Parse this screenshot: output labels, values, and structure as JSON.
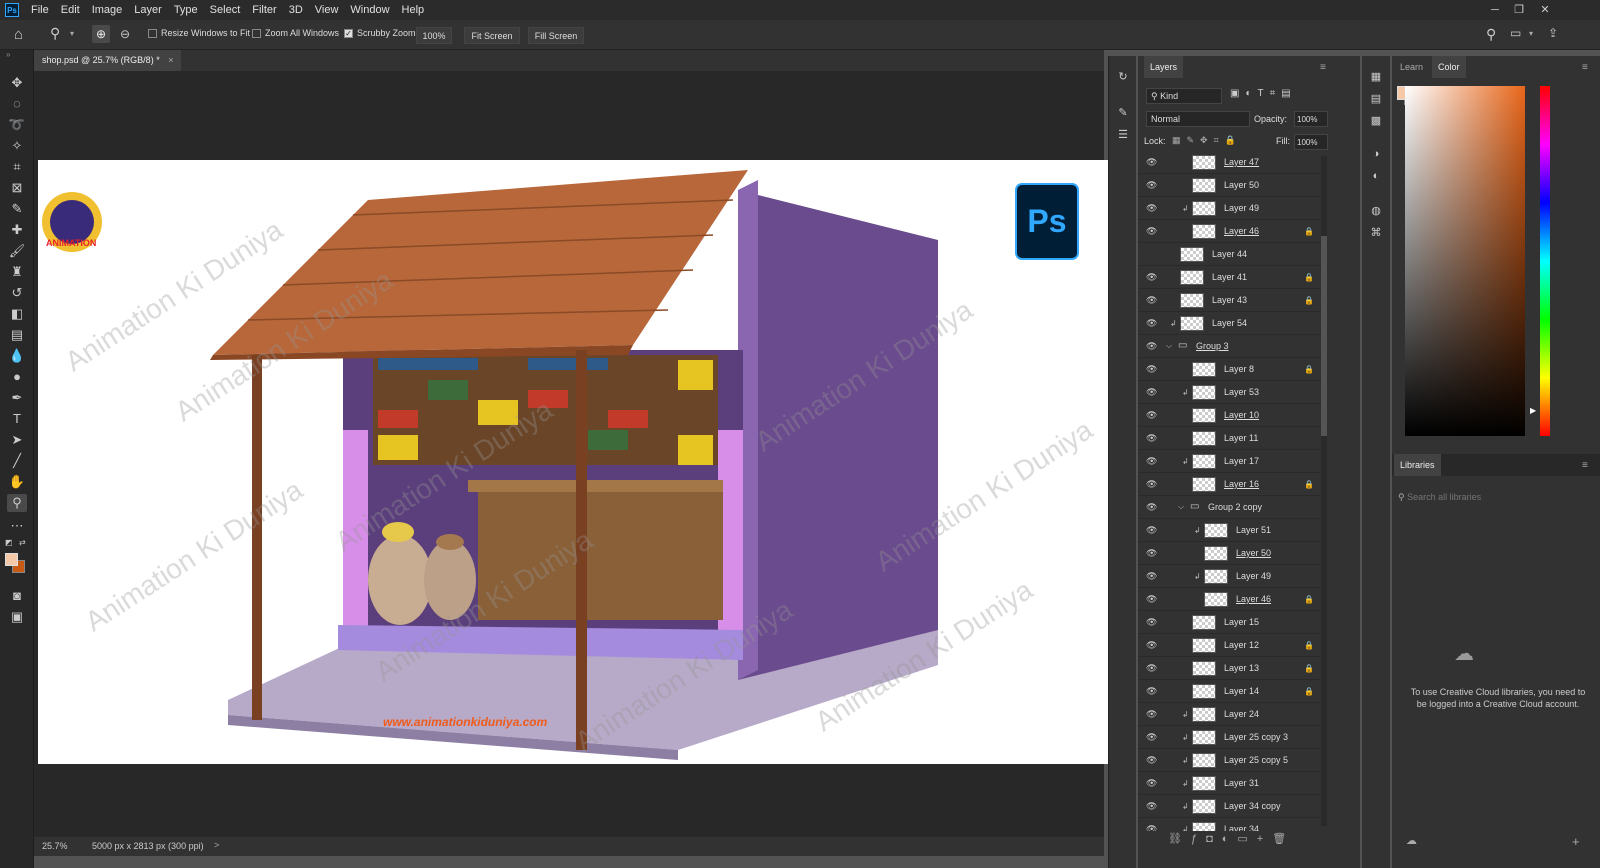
{
  "menubar": {
    "logo": "Ps",
    "items": [
      "File",
      "Edit",
      "Image",
      "Layer",
      "Type",
      "Select",
      "Filter",
      "3D",
      "View",
      "Window",
      "Help"
    ]
  },
  "options": {
    "resize_windows": "Resize Windows to Fit",
    "zoom_all": "Zoom All Windows",
    "scrubby_zoom": "Scrubby Zoom",
    "zoom_value": "100%",
    "fit_screen": "Fit Screen",
    "fill_screen": "Fill Screen"
  },
  "document": {
    "tab_title": "shop.psd @ 25.7% (RGB/8) *",
    "tab_close": "×",
    "zoom": "25.7%",
    "info": "5000 px x 2813 px (300 ppi)",
    "arrow": ">"
  },
  "artwork": {
    "watermark": "Animation Ki Duniya",
    "website": "www.animationkiduniya.com",
    "logo_text": "ANIMATION",
    "ps_badge": "Ps"
  },
  "layers_panel": {
    "title": "Layers",
    "filter_kind": "Kind",
    "blend_mode": "Normal",
    "opacity_label": "Opacity:",
    "opacity_value": "100%",
    "lock_label": "Lock:",
    "fill_label": "Fill:",
    "fill_value": "100%",
    "layers": [
      {
        "name": "Layer 47",
        "indent": 1,
        "eye": true,
        "lock": false,
        "clip": false,
        "kind": "layer",
        "struck": true
      },
      {
        "name": "Layer 50",
        "indent": 1,
        "eye": true,
        "lock": false,
        "clip": false,
        "kind": "layer",
        "struck": false
      },
      {
        "name": "Layer 49",
        "indent": 1,
        "eye": true,
        "lock": false,
        "clip": true,
        "kind": "layer",
        "struck": false
      },
      {
        "name": "Layer 46",
        "indent": 1,
        "eye": true,
        "lock": true,
        "clip": false,
        "kind": "layer",
        "struck": true
      },
      {
        "name": "Layer 44",
        "indent": 0,
        "eye": false,
        "lock": false,
        "clip": false,
        "kind": "layer",
        "struck": false
      },
      {
        "name": "Layer 41",
        "indent": 0,
        "eye": true,
        "lock": true,
        "clip": false,
        "kind": "layer",
        "struck": false
      },
      {
        "name": "Layer 43",
        "indent": 0,
        "eye": true,
        "lock": true,
        "clip": false,
        "kind": "layer",
        "struck": false
      },
      {
        "name": "Layer 54",
        "indent": 0,
        "eye": true,
        "lock": false,
        "clip": true,
        "kind": "layer",
        "struck": false
      },
      {
        "name": "Group 3",
        "indent": 0,
        "eye": true,
        "lock": false,
        "clip": false,
        "kind": "group",
        "struck": true
      },
      {
        "name": "Layer 8",
        "indent": 1,
        "eye": true,
        "lock": true,
        "clip": false,
        "kind": "layer",
        "struck": false
      },
      {
        "name": "Layer 53",
        "indent": 1,
        "eye": true,
        "lock": false,
        "clip": true,
        "kind": "layer",
        "struck": false
      },
      {
        "name": "Layer 10",
        "indent": 1,
        "eye": true,
        "lock": false,
        "clip": false,
        "kind": "layer",
        "struck": true
      },
      {
        "name": "Layer 11",
        "indent": 1,
        "eye": true,
        "lock": false,
        "clip": false,
        "kind": "layer",
        "struck": false
      },
      {
        "name": "Layer 17",
        "indent": 1,
        "eye": true,
        "lock": false,
        "clip": true,
        "kind": "layer",
        "struck": false
      },
      {
        "name": "Layer 16",
        "indent": 1,
        "eye": true,
        "lock": true,
        "clip": false,
        "kind": "layer",
        "struck": true
      },
      {
        "name": "Group 2 copy",
        "indent": 1,
        "eye": true,
        "lock": false,
        "clip": false,
        "kind": "group",
        "struck": false
      },
      {
        "name": "Layer 51",
        "indent": 2,
        "eye": true,
        "lock": false,
        "clip": true,
        "kind": "layer",
        "struck": false
      },
      {
        "name": "Layer 50",
        "indent": 2,
        "eye": true,
        "lock": false,
        "clip": false,
        "kind": "layer",
        "struck": true
      },
      {
        "name": "Layer 49",
        "indent": 2,
        "eye": true,
        "lock": false,
        "clip": true,
        "kind": "layer",
        "struck": false
      },
      {
        "name": "Layer 46",
        "indent": 2,
        "eye": true,
        "lock": true,
        "clip": false,
        "kind": "layer",
        "struck": true
      },
      {
        "name": "Layer 15",
        "indent": 1,
        "eye": true,
        "lock": false,
        "clip": false,
        "kind": "layer",
        "struck": false
      },
      {
        "name": "Layer 12",
        "indent": 1,
        "eye": true,
        "lock": true,
        "clip": false,
        "kind": "layer",
        "struck": false
      },
      {
        "name": "Layer 13",
        "indent": 1,
        "eye": true,
        "lock": true,
        "clip": false,
        "kind": "layer",
        "struck": false
      },
      {
        "name": "Layer 14",
        "indent": 1,
        "eye": true,
        "lock": true,
        "clip": false,
        "kind": "layer",
        "struck": false
      },
      {
        "name": "Layer 24",
        "indent": 1,
        "eye": true,
        "lock": false,
        "clip": true,
        "kind": "layer",
        "struck": false
      },
      {
        "name": "Layer 25 copy 3",
        "indent": 1,
        "eye": true,
        "lock": false,
        "clip": true,
        "kind": "layer",
        "struck": false
      },
      {
        "name": "Layer 25 copy 5",
        "indent": 1,
        "eye": true,
        "lock": false,
        "clip": true,
        "kind": "layer",
        "struck": false
      },
      {
        "name": "Layer 31",
        "indent": 1,
        "eye": true,
        "lock": false,
        "clip": true,
        "kind": "layer",
        "struck": false
      },
      {
        "name": "Layer 34 copy",
        "indent": 1,
        "eye": true,
        "lock": false,
        "clip": true,
        "kind": "layer",
        "struck": false
      },
      {
        "name": "Layer 34",
        "indent": 1,
        "eye": true,
        "lock": false,
        "clip": true,
        "kind": "layer",
        "struck": false
      }
    ]
  },
  "right_panel": {
    "tab_learn": "Learn",
    "tab_color": "Color",
    "libraries_title": "Libraries",
    "search_placeholder": "Search all libraries",
    "cc_message": "To use Creative Cloud libraries, you need to be logged into a Creative Cloud account."
  },
  "colors": {
    "foreground": "#f5c8a8",
    "background": "#c85a14",
    "hue": "#e8661a"
  }
}
